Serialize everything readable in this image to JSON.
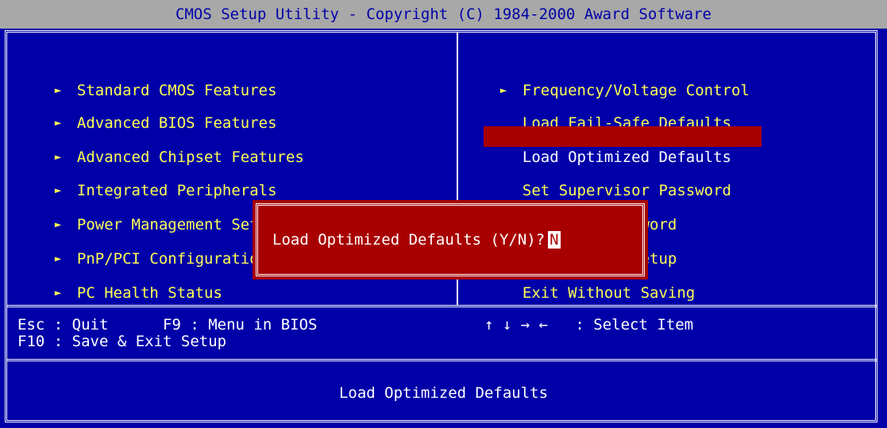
{
  "title": "CMOS Setup Utility - Copyright (C) 1984-2000 Award Software",
  "left_menu": [
    {
      "label": "Standard CMOS Features",
      "has_submenu": true
    },
    {
      "label": "Advanced BIOS Features",
      "has_submenu": true
    },
    {
      "label": "Advanced Chipset Features",
      "has_submenu": true
    },
    {
      "label": "Integrated Peripherals",
      "has_submenu": true
    },
    {
      "label": "Power Management Setup",
      "has_submenu": true
    },
    {
      "label": "PnP/PCI Configurations",
      "has_submenu": true
    },
    {
      "label": "PC Health Status",
      "has_submenu": true
    }
  ],
  "right_menu": [
    {
      "label": "Frequency/Voltage Control",
      "has_submenu": true
    },
    {
      "label": "Load Fail-Safe Defaults",
      "has_submenu": false
    },
    {
      "label": "Load Optimized Defaults",
      "has_submenu": false,
      "selected": true
    },
    {
      "label": "Set Supervisor Password",
      "has_submenu": false
    },
    {
      "label": "Set User Password",
      "has_submenu": false
    },
    {
      "label": "Save & Exit Setup",
      "has_submenu": false
    },
    {
      "label": "Exit Without Saving",
      "has_submenu": false
    }
  ],
  "arrow_glyph": "►",
  "footer": {
    "line1_left": "Esc : Quit      F9 : Menu in BIOS",
    "line1_right": "↑ ↓ → ←   : Select Item",
    "line2_left": "F10 : Save & Exit Setup"
  },
  "status_text": "Load Optimized Defaults",
  "dialog": {
    "prompt": "Load Optimized Defaults (Y/N)?",
    "answer": "N"
  },
  "colors": {
    "background": "#0000a8",
    "menu_text": "#ffff54",
    "highlight": "#a80000",
    "title_bar": "#a8a8a8"
  }
}
